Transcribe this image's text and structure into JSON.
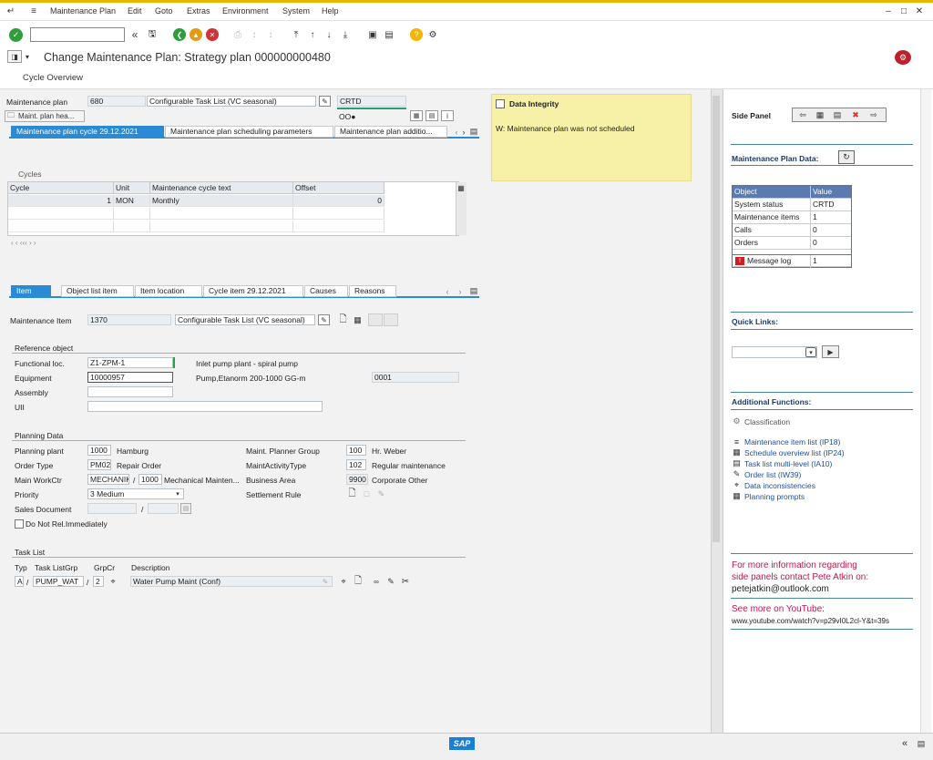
{
  "menu": {
    "items": [
      "Maintenance Plan",
      "Edit",
      "Goto",
      "Extras",
      "Environment",
      "System",
      "Help"
    ]
  },
  "title": "Change Maintenance Plan: Strategy plan 000000000480",
  "app_toolbar": {
    "cycle_overview": "Cycle Overview"
  },
  "header": {
    "plan_label": "Maintenance plan",
    "plan_number": "680",
    "plan_desc": "Configurable Task List (VC seasonal)",
    "status": "CRTD",
    "maint_plan_hdr_btn": "Maint. plan hea...",
    "status2": "OO●"
  },
  "tabs_top": {
    "t1": "Maintenance plan cycle 29.12.2021",
    "t2": "Maintenance plan scheduling parameters",
    "t3": "Maintenance plan additio..."
  },
  "cycles": {
    "title": "Cycles",
    "headers": [
      "Cycle",
      "Unit",
      "Maintenance cycle text",
      "Offset"
    ],
    "row1": {
      "cycle": "1",
      "unit": "MON",
      "text": "Monthly",
      "offset": "0"
    },
    "scroll_label": "‹ ‹ ‹‹‹ › ›"
  },
  "data_integrity": {
    "title": "Data Integrity",
    "message": "W: Maintenance plan was not scheduled"
  },
  "tabs_item": {
    "t1": "Item",
    "t2": "Object list item",
    "t3": "Item location",
    "t4": "Cycle item 29.12.2021",
    "t5": "Causes",
    "t6": "Reasons"
  },
  "item": {
    "label": "Maintenance Item",
    "number": "1370",
    "desc": "Configurable Task List (VC seasonal)"
  },
  "ref_object": {
    "title": "Reference object",
    "func_loc_label": "Functional loc.",
    "func_loc_value": "Z1-ZPM-1",
    "func_loc_desc": "Inlet pump plant - spiral pump",
    "equip_label": "Equipment",
    "equip_value": "10000957",
    "equip_desc": "Pump,Etanorm 200-1000 GG-m",
    "equip_extra": "0001",
    "assembly_label": "Assembly",
    "uii_label": "UII"
  },
  "planning": {
    "title": "Planning Data",
    "plant_label": "Planning plant",
    "plant_value": "1000",
    "plant_desc": "Hamburg",
    "planner_label": "Maint. Planner Group",
    "planner_value": "100",
    "planner_desc": "Hr. Weber",
    "order_type_label": "Order Type",
    "order_type_value": "PM02",
    "order_type_desc": "Repair Order",
    "activity_label": "MaintActivityType",
    "activity_value": "102",
    "activity_desc": "Regular maintenance",
    "workctr_label": "Main WorkCtr",
    "workctr_value": "MECHANIK",
    "workctr_slash": "/",
    "workctr_plant": "1000",
    "workctr_desc": "Mechanical Mainten...",
    "bus_area_label": "Business Area",
    "bus_area_value": "9900",
    "bus_area_desc": "Corporate Other",
    "priority_label": "Priority",
    "priority_value": "3 Medium",
    "settle_label": "Settlement Rule",
    "sales_label": "Sales Document",
    "sales_slash": "/",
    "do_not_rel": "Do Not Rel.Immediately"
  },
  "task_list": {
    "title": "Task List",
    "typ_label": "Typ",
    "grp_label": "Task ListGrp",
    "grpcr_label": "GrpCr",
    "desc_label": "Description",
    "typ_value": "A",
    "slash1": "/",
    "grp_value": "PUMP_WAT",
    "slash2": "/",
    "grpcr_value": "2",
    "desc_value": "Water Pump Maint (Conf)"
  },
  "side_panel": {
    "title": "Side Panel",
    "maint_plan_data": "Maintenance Plan Data:",
    "table_headers": [
      "Object",
      "Value"
    ],
    "rows": [
      {
        "obj": "System status",
        "val": "CRTD"
      },
      {
        "obj": "Maintenance items",
        "val": "1"
      },
      {
        "obj": "Calls",
        "val": "0"
      },
      {
        "obj": "Orders",
        "val": "0"
      },
      {
        "obj": "Message log",
        "val": "1"
      }
    ],
    "quick_links": "Quick Links:",
    "additional_functions": "Additional Functions:",
    "classification": "Classification",
    "links": [
      "Maintenance item list (IP18)",
      "Schedule overview list (IP24)",
      "Task list multi-level (IA10)",
      "Order list (IW39)",
      "Data inconsistencies",
      "Planning prompts"
    ],
    "info1": "For more information regarding",
    "info2": "side panels contact Pete Atkin on:",
    "email": "petejatkin@outlook.com",
    "youtube_label": "See more on YouTube:",
    "youtube_url": "www.youtube.com/watch?v=p29vI0L2cl-Y&t=39s"
  },
  "status_bar": {
    "sap_logo": "SAP"
  },
  "colors": {
    "accent": "#2b8ad4",
    "note_yellow": "#f6f1a6",
    "side_text_red": "#c0174a",
    "sap_blue": "#1a7fd6"
  }
}
